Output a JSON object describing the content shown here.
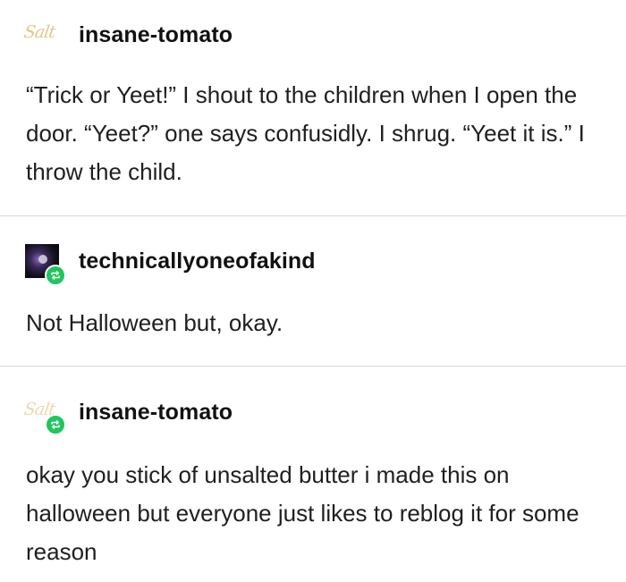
{
  "thread": [
    {
      "avatar_text": "Salt",
      "avatar_icon": "salt-logo-icon",
      "username": "insane-tomato",
      "is_reblog": false,
      "text": "“Trick or Yeet!” I shout to the children when I open the door. “Yeet?” one says confusidly. I shrug. “Yeet it is.” I throw the child."
    },
    {
      "avatar_icon": "dark-purple-avatar-icon",
      "username": "technicallyoneofakind",
      "is_reblog": true,
      "text": "Not Halloween but, okay."
    },
    {
      "avatar_text": "Salt",
      "avatar_icon": "salt-logo-icon",
      "username": "insane-tomato",
      "is_reblog": true,
      "text": "okay you stick of unsalted butter i made this on halloween but everyone just likes to reblog it for some reason"
    }
  ],
  "colors": {
    "reblog_badge": "#22c55e",
    "divider": "#d7d7d7",
    "salt_logo": "#e4c78f"
  }
}
